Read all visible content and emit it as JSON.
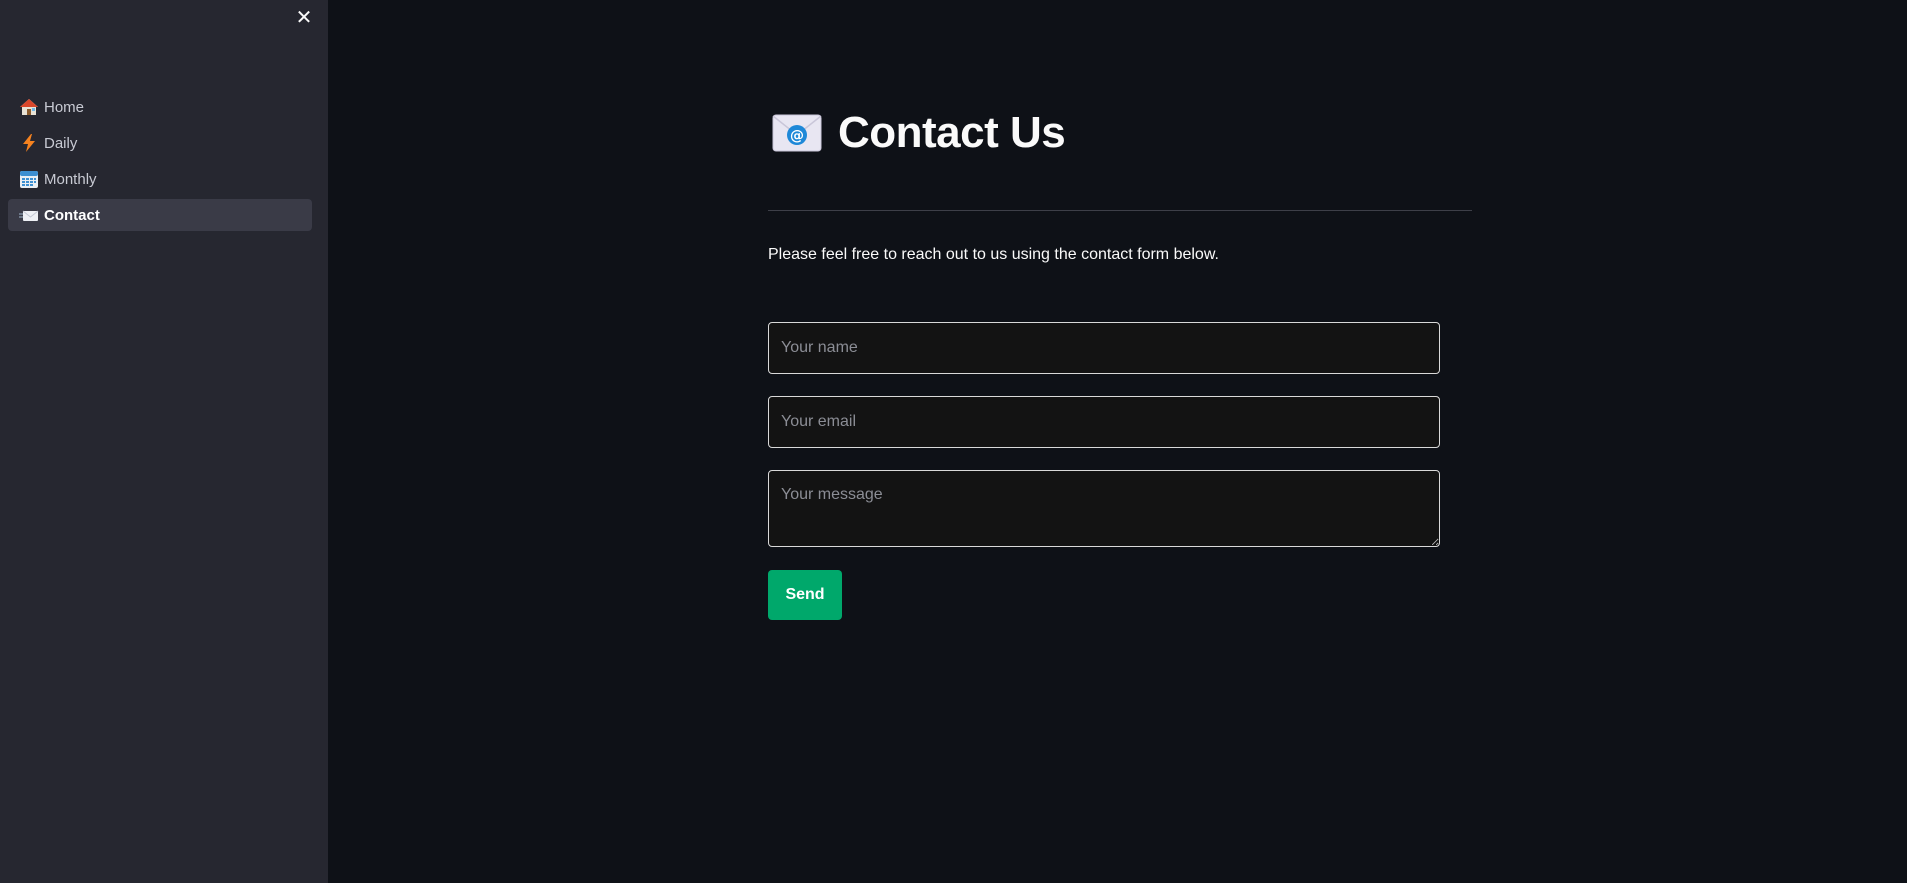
{
  "sidebar": {
    "close_label": "✕",
    "items": [
      {
        "label": "Home",
        "icon": "house-icon",
        "active": false
      },
      {
        "label": "Daily",
        "icon": "lightning-icon",
        "active": false
      },
      {
        "label": "Monthly",
        "icon": "calendar-icon",
        "active": false
      },
      {
        "label": "Contact",
        "icon": "email-icon",
        "active": true
      }
    ]
  },
  "main": {
    "title": "Contact Us",
    "title_icon": "email-at-icon",
    "intro": "Please feel free to reach out to us using the contact form below.",
    "form": {
      "name_placeholder": "Your name",
      "email_placeholder": "Your email",
      "message_placeholder": "Your message",
      "send_label": "Send"
    }
  },
  "colors": {
    "background": "#0e1117",
    "sidebar": "#262730",
    "active_item": "#3a3b47",
    "button": "#00a86b"
  }
}
